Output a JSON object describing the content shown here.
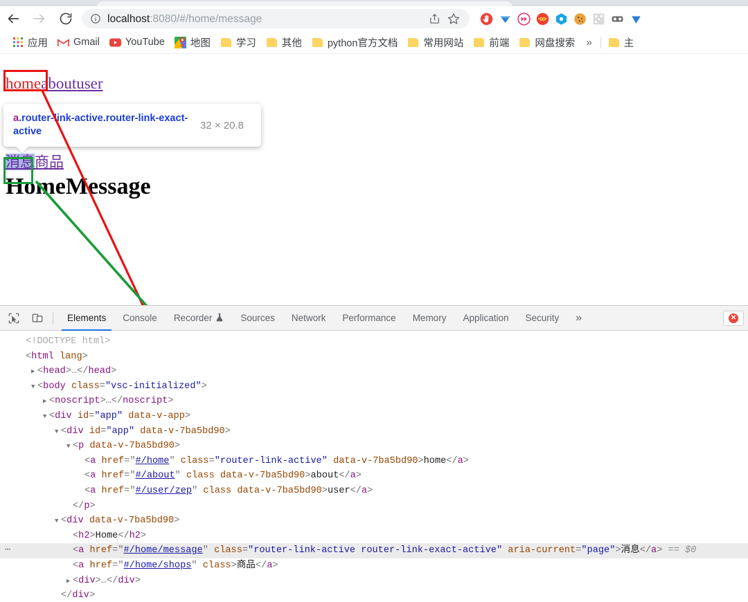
{
  "browser": {
    "nav": {
      "back_icon": "arrow-left-icon",
      "forward_icon": "arrow-right-icon",
      "reload_icon": "reload-icon"
    },
    "omnibox": {
      "info_icon": "info-circle-icon",
      "host": "localhost",
      "path": ":8080/#/home/message",
      "full_url": "localhost:8080/#/home/message",
      "share_icon": "share-icon",
      "bookmark_icon": "star-icon"
    },
    "extensions": [
      {
        "name": "adblock-extension-icon",
        "color": "#e8453c"
      },
      {
        "name": "diamond-extension-icon",
        "color": "#2a7fd4"
      },
      {
        "name": "video-speed-extension-icon",
        "color": "#e8336d"
      },
      {
        "name": "infinity-extension-icon",
        "color": "#f04030"
      },
      {
        "name": "hexagon-extension-icon",
        "color": "#1aa3e8"
      },
      {
        "name": "cookie-extension-icon",
        "color": "#e8a33c"
      },
      {
        "name": "qrcode-extension-icon",
        "color": "#d8d8d8"
      },
      {
        "name": "glasses-extension-icon",
        "color": "#6b6b6b"
      },
      {
        "name": "pen-extension-icon",
        "color": "#2a7fd4"
      }
    ],
    "bookmarks": {
      "items": [
        {
          "label": "应用",
          "icon": "apps-grid-icon"
        },
        {
          "label": "Gmail",
          "icon": "gmail-icon"
        },
        {
          "label": "YouTube",
          "icon": "youtube-icon"
        },
        {
          "label": "地图",
          "icon": "google-maps-icon"
        },
        {
          "label": "学习",
          "icon": "folder-icon"
        },
        {
          "label": "其他",
          "icon": "folder-icon"
        },
        {
          "label": "python官方文档",
          "icon": "folder-icon"
        },
        {
          "label": "常用网站",
          "icon": "folder-icon"
        },
        {
          "label": "前端",
          "icon": "folder-icon"
        },
        {
          "label": "网盘搜索",
          "icon": "folder-icon"
        }
      ],
      "overflow_label": "»",
      "trailing": {
        "label": "主",
        "icon": "folder-icon"
      }
    }
  },
  "page": {
    "nav_links": [
      {
        "label": "home",
        "state": "active"
      },
      {
        "label": "about",
        "state": "visited"
      },
      {
        "label": "user",
        "state": "visited"
      }
    ],
    "sub_links": [
      {
        "label": "消息",
        "state": "selected"
      },
      {
        "label": "商品",
        "state": "visited"
      }
    ],
    "heading": "HomeMessage",
    "inspector_tooltip": {
      "tag": "a",
      "classes": ".router-link-active.router-link-exact-active",
      "dimensions": "32 × 20.8"
    }
  },
  "devtools": {
    "inspect_icon": "cursor-inspect-icon",
    "device_toolbar_icon": "device-toolbar-icon",
    "tabs": [
      {
        "label": "Elements",
        "active": true,
        "icon": null
      },
      {
        "label": "Console",
        "active": false,
        "icon": null
      },
      {
        "label": "Recorder",
        "active": false,
        "icon": "experiment-flask-icon"
      },
      {
        "label": "Sources",
        "active": false,
        "icon": null
      },
      {
        "label": "Network",
        "active": false,
        "icon": null
      },
      {
        "label": "Performance",
        "active": false,
        "icon": null
      },
      {
        "label": "Memory",
        "active": false,
        "icon": null
      },
      {
        "label": "Application",
        "active": false,
        "icon": null
      },
      {
        "label": "Security",
        "active": false,
        "icon": null
      }
    ],
    "more_tabs_label": "»",
    "error_badge": {
      "icon": "error-circle-icon",
      "symbol": "✕"
    },
    "dom_lines": [
      {
        "id": "l1",
        "indent": 0,
        "twisty": "none",
        "selected": false,
        "gutter": "",
        "segments": [
          {
            "t": "doct",
            "v": "<!DOCTYPE html>"
          }
        ]
      },
      {
        "id": "l2",
        "indent": 0,
        "twisty": "none",
        "selected": false,
        "gutter": "",
        "segments": [
          {
            "t": "punct",
            "v": "<"
          },
          {
            "t": "tag",
            "v": "html"
          },
          {
            "t": "sp",
            "v": " "
          },
          {
            "t": "attr",
            "v": "lang"
          },
          {
            "t": "punct",
            "v": ">"
          }
        ]
      },
      {
        "id": "l3",
        "indent": 1,
        "twisty": "closed",
        "selected": false,
        "gutter": "",
        "segments": [
          {
            "t": "punct",
            "v": "<"
          },
          {
            "t": "tag",
            "v": "head"
          },
          {
            "t": "punct",
            "v": ">"
          },
          {
            "t": "punct",
            "v": "…"
          },
          {
            "t": "punct",
            "v": "</"
          },
          {
            "t": "tag",
            "v": "head"
          },
          {
            "t": "punct",
            "v": ">"
          }
        ]
      },
      {
        "id": "l4",
        "indent": 1,
        "twisty": "open",
        "selected": false,
        "gutter": "",
        "segments": [
          {
            "t": "punct",
            "v": "<"
          },
          {
            "t": "tag",
            "v": "body"
          },
          {
            "t": "sp",
            "v": " "
          },
          {
            "t": "attr",
            "v": "class"
          },
          {
            "t": "punct",
            "v": "="
          },
          {
            "t": "val",
            "v": "\"vsc-initialized\""
          },
          {
            "t": "punct",
            "v": ">"
          }
        ]
      },
      {
        "id": "l5",
        "indent": 2,
        "twisty": "closed",
        "selected": false,
        "gutter": "",
        "segments": [
          {
            "t": "punct",
            "v": "<"
          },
          {
            "t": "tag",
            "v": "noscript"
          },
          {
            "t": "punct",
            "v": ">"
          },
          {
            "t": "punct",
            "v": "…"
          },
          {
            "t": "punct",
            "v": "</"
          },
          {
            "t": "tag",
            "v": "noscript"
          },
          {
            "t": "punct",
            "v": ">"
          }
        ]
      },
      {
        "id": "l6",
        "indent": 2,
        "twisty": "open",
        "selected": false,
        "gutter": "",
        "segments": [
          {
            "t": "punct",
            "v": "<"
          },
          {
            "t": "tag",
            "v": "div"
          },
          {
            "t": "sp",
            "v": " "
          },
          {
            "t": "attr",
            "v": "id"
          },
          {
            "t": "punct",
            "v": "="
          },
          {
            "t": "val",
            "v": "\"app\""
          },
          {
            "t": "sp",
            "v": " "
          },
          {
            "t": "attr",
            "v": "data-v-app"
          },
          {
            "t": "punct",
            "v": ">"
          }
        ]
      },
      {
        "id": "l7",
        "indent": 3,
        "twisty": "open",
        "selected": false,
        "gutter": "",
        "segments": [
          {
            "t": "punct",
            "v": "<"
          },
          {
            "t": "tag",
            "v": "div"
          },
          {
            "t": "sp",
            "v": " "
          },
          {
            "t": "attr",
            "v": "id"
          },
          {
            "t": "punct",
            "v": "="
          },
          {
            "t": "val",
            "v": "\"app\""
          },
          {
            "t": "sp",
            "v": " "
          },
          {
            "t": "attr",
            "v": "data-v-7ba5bd90"
          },
          {
            "t": "punct",
            "v": ">"
          }
        ]
      },
      {
        "id": "l8",
        "indent": 4,
        "twisty": "open",
        "selected": false,
        "gutter": "",
        "segments": [
          {
            "t": "punct",
            "v": "<"
          },
          {
            "t": "tag",
            "v": "p"
          },
          {
            "t": "sp",
            "v": " "
          },
          {
            "t": "attr",
            "v": "data-v-7ba5bd90"
          },
          {
            "t": "punct",
            "v": ">"
          }
        ]
      },
      {
        "id": "l9",
        "indent": 5,
        "twisty": "none",
        "selected": false,
        "gutter": "",
        "segments": [
          {
            "t": "punct",
            "v": "<"
          },
          {
            "t": "tag",
            "v": "a"
          },
          {
            "t": "sp",
            "v": " "
          },
          {
            "t": "attr",
            "v": "href"
          },
          {
            "t": "punct",
            "v": "="
          },
          {
            "t": "punct",
            "v": "\""
          },
          {
            "t": "lnkv",
            "v": "#/home"
          },
          {
            "t": "punct",
            "v": "\""
          },
          {
            "t": "sp",
            "v": " "
          },
          {
            "t": "attr",
            "v": "class"
          },
          {
            "t": "punct",
            "v": "="
          },
          {
            "t": "val",
            "v": "\"router-link-active\""
          },
          {
            "t": "sp",
            "v": " "
          },
          {
            "t": "attr",
            "v": "data-v-7ba5bd90"
          },
          {
            "t": "punct",
            "v": ">"
          },
          {
            "t": "txt",
            "v": "home"
          },
          {
            "t": "punct",
            "v": "</"
          },
          {
            "t": "tag",
            "v": "a"
          },
          {
            "t": "punct",
            "v": ">"
          }
        ]
      },
      {
        "id": "l10",
        "indent": 5,
        "twisty": "none",
        "selected": false,
        "gutter": "",
        "segments": [
          {
            "t": "punct",
            "v": "<"
          },
          {
            "t": "tag",
            "v": "a"
          },
          {
            "t": "sp",
            "v": " "
          },
          {
            "t": "attr",
            "v": "href"
          },
          {
            "t": "punct",
            "v": "="
          },
          {
            "t": "punct",
            "v": "\""
          },
          {
            "t": "lnkv",
            "v": "#/about"
          },
          {
            "t": "punct",
            "v": "\""
          },
          {
            "t": "sp",
            "v": " "
          },
          {
            "t": "attr",
            "v": "class"
          },
          {
            "t": "sp",
            "v": " "
          },
          {
            "t": "attr",
            "v": "data-v-7ba5bd90"
          },
          {
            "t": "punct",
            "v": ">"
          },
          {
            "t": "txt",
            "v": "about"
          },
          {
            "t": "punct",
            "v": "</"
          },
          {
            "t": "tag",
            "v": "a"
          },
          {
            "t": "punct",
            "v": ">"
          }
        ]
      },
      {
        "id": "l11",
        "indent": 5,
        "twisty": "none",
        "selected": false,
        "gutter": "",
        "segments": [
          {
            "t": "punct",
            "v": "<"
          },
          {
            "t": "tag",
            "v": "a"
          },
          {
            "t": "sp",
            "v": " "
          },
          {
            "t": "attr",
            "v": "href"
          },
          {
            "t": "punct",
            "v": "="
          },
          {
            "t": "punct",
            "v": "\""
          },
          {
            "t": "lnkv",
            "v": "#/user/zep"
          },
          {
            "t": "punct",
            "v": "\""
          },
          {
            "t": "sp",
            "v": " "
          },
          {
            "t": "attr",
            "v": "class"
          },
          {
            "t": "sp",
            "v": " "
          },
          {
            "t": "attr",
            "v": "data-v-7ba5bd90"
          },
          {
            "t": "punct",
            "v": ">"
          },
          {
            "t": "txt",
            "v": "user"
          },
          {
            "t": "punct",
            "v": "</"
          },
          {
            "t": "tag",
            "v": "a"
          },
          {
            "t": "punct",
            "v": ">"
          }
        ]
      },
      {
        "id": "l12",
        "indent": 4,
        "twisty": "none",
        "selected": false,
        "gutter": "",
        "segments": [
          {
            "t": "punct",
            "v": "</"
          },
          {
            "t": "tag",
            "v": "p"
          },
          {
            "t": "punct",
            "v": ">"
          }
        ]
      },
      {
        "id": "l13",
        "indent": 3,
        "twisty": "open",
        "selected": false,
        "gutter": "",
        "segments": [
          {
            "t": "punct",
            "v": "<"
          },
          {
            "t": "tag",
            "v": "div"
          },
          {
            "t": "sp",
            "v": " "
          },
          {
            "t": "attr",
            "v": "data-v-7ba5bd90"
          },
          {
            "t": "punct",
            "v": ">"
          }
        ]
      },
      {
        "id": "l14",
        "indent": 4,
        "twisty": "none",
        "selected": false,
        "gutter": "",
        "segments": [
          {
            "t": "punct",
            "v": "<"
          },
          {
            "t": "tag",
            "v": "h2"
          },
          {
            "t": "punct",
            "v": ">"
          },
          {
            "t": "txt",
            "v": "Home"
          },
          {
            "t": "punct",
            "v": "</"
          },
          {
            "t": "tag",
            "v": "h2"
          },
          {
            "t": "punct",
            "v": ">"
          }
        ]
      },
      {
        "id": "l15",
        "indent": 4,
        "twisty": "none",
        "selected": true,
        "gutter": "⋯",
        "segments": [
          {
            "t": "punct",
            "v": "<"
          },
          {
            "t": "tag",
            "v": "a"
          },
          {
            "t": "sp",
            "v": " "
          },
          {
            "t": "attr",
            "v": "href"
          },
          {
            "t": "punct",
            "v": "="
          },
          {
            "t": "punct",
            "v": "\""
          },
          {
            "t": "lnkv",
            "v": "#/home/message"
          },
          {
            "t": "punct",
            "v": "\""
          },
          {
            "t": "sp",
            "v": " "
          },
          {
            "t": "attr",
            "v": "class"
          },
          {
            "t": "punct",
            "v": "="
          },
          {
            "t": "val",
            "v": "\"router-link-active router-link-exact-active\""
          },
          {
            "t": "sp",
            "v": " "
          },
          {
            "t": "attr",
            "v": "aria-current"
          },
          {
            "t": "punct",
            "v": "="
          },
          {
            "t": "val",
            "v": "\"page\""
          },
          {
            "t": "punct",
            "v": ">"
          },
          {
            "t": "txt",
            "v": "消息"
          },
          {
            "t": "punct",
            "v": "</"
          },
          {
            "t": "tag",
            "v": "a"
          },
          {
            "t": "punct",
            "v": ">"
          },
          {
            "t": "sp",
            "v": " "
          },
          {
            "t": "dollar",
            "v": "== $0"
          }
        ]
      },
      {
        "id": "l16",
        "indent": 4,
        "twisty": "none",
        "selected": false,
        "gutter": "",
        "segments": [
          {
            "t": "punct",
            "v": "<"
          },
          {
            "t": "tag",
            "v": "a"
          },
          {
            "t": "sp",
            "v": " "
          },
          {
            "t": "attr",
            "v": "href"
          },
          {
            "t": "punct",
            "v": "="
          },
          {
            "t": "punct",
            "v": "\""
          },
          {
            "t": "lnkv",
            "v": "#/home/shops"
          },
          {
            "t": "punct",
            "v": "\""
          },
          {
            "t": "sp",
            "v": " "
          },
          {
            "t": "attr",
            "v": "class"
          },
          {
            "t": "punct",
            "v": ">"
          },
          {
            "t": "txt",
            "v": "商品"
          },
          {
            "t": "punct",
            "v": "</"
          },
          {
            "t": "tag",
            "v": "a"
          },
          {
            "t": "punct",
            "v": ">"
          }
        ]
      },
      {
        "id": "l17",
        "indent": 4,
        "twisty": "closed",
        "selected": false,
        "gutter": "",
        "segments": [
          {
            "t": "punct",
            "v": "<"
          },
          {
            "t": "tag",
            "v": "div"
          },
          {
            "t": "punct",
            "v": ">"
          },
          {
            "t": "punct",
            "v": "…"
          },
          {
            "t": "punct",
            "v": "</"
          },
          {
            "t": "tag",
            "v": "div"
          },
          {
            "t": "punct",
            "v": ">"
          }
        ]
      },
      {
        "id": "l18",
        "indent": 3,
        "twisty": "none",
        "selected": false,
        "gutter": "",
        "segments": [
          {
            "t": "punct",
            "v": "</"
          },
          {
            "t": "tag",
            "v": "div"
          },
          {
            "t": "punct",
            "v": ">"
          }
        ]
      }
    ]
  },
  "annotations": {
    "red_box_label": "router-link-active-highlight",
    "green_box_label": "router-link-exact-active-highlight",
    "red_color": "#e81313",
    "green_color": "#1a9c3a"
  }
}
